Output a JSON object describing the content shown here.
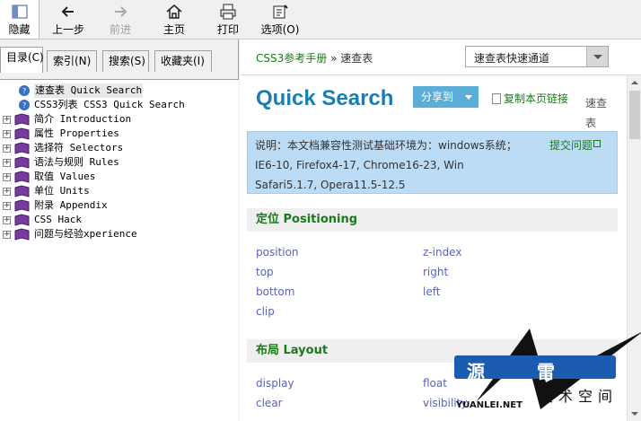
{
  "toolbar": {
    "hide": "隐藏",
    "back": "上一步",
    "forward": "前进",
    "home": "主页",
    "print": "打印",
    "options": "选项(O)"
  },
  "left_tabs": [
    "目录(C)",
    "索引(N)",
    "搜索(S)",
    "收藏夹(I)"
  ],
  "tree": [
    {
      "label": "速查表 Quick Search",
      "expandable": false,
      "selected": true
    },
    {
      "label": "CSS3列表 CSS3 Quick Search",
      "expandable": false,
      "selected": false
    },
    {
      "label": "简介 Introduction",
      "expandable": true
    },
    {
      "label": "属性 Properties",
      "expandable": true
    },
    {
      "label": "选择符 Selectors",
      "expandable": true
    },
    {
      "label": "语法与规则 Rules",
      "expandable": true
    },
    {
      "label": "取值 Values",
      "expandable": true
    },
    {
      "label": "单位 Units",
      "expandable": true
    },
    {
      "label": "附录 Appendix",
      "expandable": true
    },
    {
      "label": "CSS Hack",
      "expandable": true
    },
    {
      "label": "问题与经验xperience",
      "expandable": true
    }
  ],
  "breadcrumb": {
    "root": "CSS3参考手册",
    "sep": "»",
    "current": "速查表"
  },
  "quick_select": {
    "value": "速查表快速通道"
  },
  "page": {
    "title": "Quick Search",
    "share": "分享到",
    "copy_link": "复制本页链接",
    "quick_label": "速查表"
  },
  "note": {
    "line1": "说明：本文档兼容性测试基础环境为：windows系统；",
    "line2": "IE6-10, Firefox4-17, Chrome16-23, Win",
    "line3": "Safari5.1.7, Opera11.5-12.5",
    "link": "提交问题"
  },
  "sections": [
    {
      "title": "定位 Positioning",
      "props": [
        "position",
        "z-index",
        "top",
        "right",
        "bottom",
        "left",
        "clip"
      ]
    },
    {
      "title": "布局 Layout",
      "props": [
        "display",
        "float",
        "clear",
        "visibility"
      ]
    }
  ],
  "watermark": {
    "c1": "源",
    "c2": "雷",
    "sub": "技术空间",
    "url": "YUANLEI.NET"
  },
  "colors": {
    "title": "#1a7fb0",
    "link_green": "#1a7a1a",
    "prop": "#5a64b4",
    "note_bg": "#bcdcf6"
  }
}
